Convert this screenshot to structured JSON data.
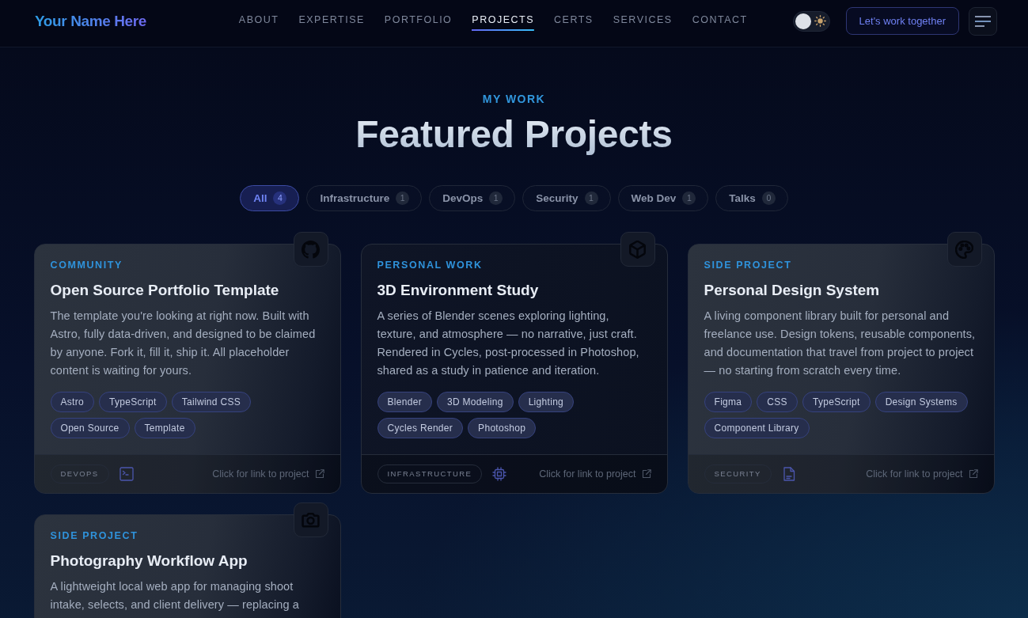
{
  "header": {
    "logo": "Your Name Here",
    "nav": [
      {
        "label": "ABOUT",
        "selected": false
      },
      {
        "label": "EXPERTISE",
        "selected": false
      },
      {
        "label": "PORTFOLIO",
        "selected": false
      },
      {
        "label": "PROJECTS",
        "selected": true
      },
      {
        "label": "CERTS",
        "selected": false
      },
      {
        "label": "SERVICES",
        "selected": false
      },
      {
        "label": "CONTACT",
        "selected": false
      }
    ],
    "theme_toggle": {
      "dark_mode": true
    },
    "cta_button": "Let's work together"
  },
  "section": {
    "eyebrow": "MY WORK",
    "title": "Featured Projects"
  },
  "filters": [
    {
      "label": "All",
      "count": "4",
      "selected": true
    },
    {
      "label": "Infrastructure",
      "count": "1",
      "selected": false
    },
    {
      "label": "DevOps",
      "count": "1",
      "selected": false
    },
    {
      "label": "Security",
      "count": "1",
      "selected": false
    },
    {
      "label": "Web Dev",
      "count": "1",
      "selected": false
    },
    {
      "label": "Talks",
      "count": "0",
      "selected": false
    }
  ],
  "projects": [
    {
      "category": "COMMUNITY",
      "title": "Open Source Portfolio Template",
      "description": "The template you're looking at right now. Built with Astro, fully data-driven, and designed to be claimed by anyone. Fork it, fill it, ship it. All placeholder content is waiting for yours.",
      "tags": [
        "Astro",
        "TypeScript",
        "Tailwind CSS",
        "Open Source",
        "Template"
      ],
      "type": "DEVOPS",
      "link": "Click for link to project",
      "highlighted": true
    },
    {
      "category": "PERSONAL WORK",
      "title": "3D Environment Study",
      "description": "A series of Blender scenes exploring lighting, texture, and atmosphere — no narrative, just craft. Rendered in Cycles, post-processed in Photoshop, shared as a study in patience and iteration.",
      "tags": [
        "Blender",
        "3D Modeling",
        "Lighting",
        "Cycles Render",
        "Photoshop"
      ],
      "type": "INFRASTRUCTURE",
      "link": "Click for link to project",
      "highlighted": false
    },
    {
      "category": "SIDE PROJECT",
      "title": "Personal Design System",
      "description": "A living component library built for personal and freelance use. Design tokens, reusable components, and documentation that travel from project to project — no starting from scratch every time.",
      "tags": [
        "Figma",
        "CSS",
        "TypeScript",
        "Design Systems",
        "Component Library"
      ],
      "type": "SECURITY",
      "link": "Click for link to project",
      "highlighted": true
    },
    {
      "category": "SIDE PROJECT",
      "title": "Photography Workflow App",
      "description": "A lightweight local web app for managing shoot intake, selects, and client delivery — replacing a",
      "highlighted": true
    }
  ]
}
